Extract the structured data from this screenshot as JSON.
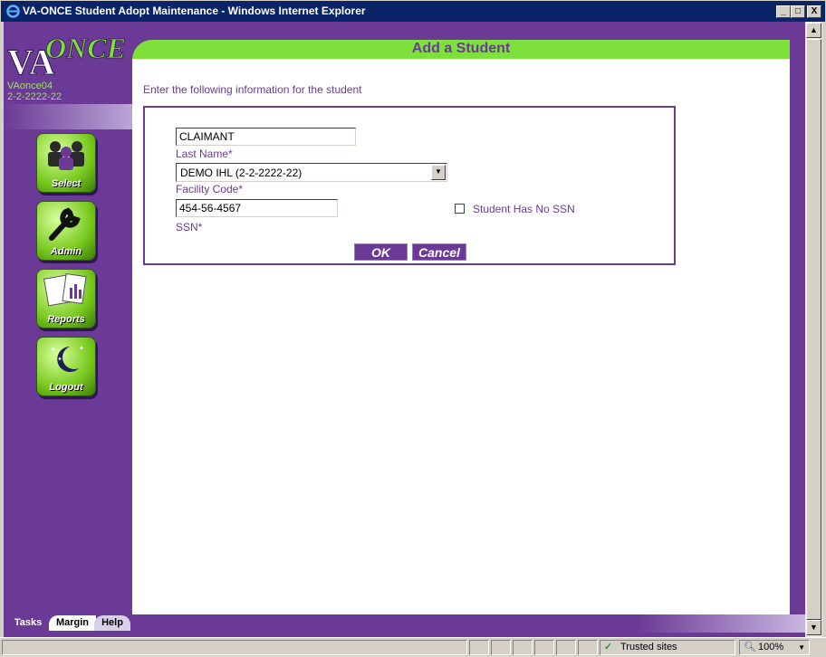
{
  "window": {
    "title": "VA-ONCE Student Adopt Maintenance - Windows Internet Explorer",
    "minimize": "_",
    "maximize": "□",
    "close": "X"
  },
  "sidebar": {
    "logo_text_va": "VA",
    "logo_text_once": "ONCE",
    "user": "VAonce04",
    "facility": "2-2-2222-22",
    "buttons": [
      {
        "label": "Select"
      },
      {
        "label": "Admin"
      },
      {
        "label": "Reports"
      },
      {
        "label": "Logout"
      }
    ],
    "tabs": [
      "Tasks",
      "Margin",
      "Help"
    ]
  },
  "header": {
    "title": "Add a Student"
  },
  "form": {
    "intro": "Enter the following information for the student",
    "last_name_value": "CLAIMANT",
    "last_name_label": "Last Name*",
    "facility_value": "DEMO IHL (2-2-2222-22)",
    "facility_label": "Facility Code*",
    "ssn_value": "454-56-4567",
    "ssn_label": "SSN*",
    "no_ssn_label": "Student Has No SSN",
    "ok_label": "OK",
    "cancel_label": "Cancel"
  },
  "statusbar": {
    "zone": "Trusted sites",
    "zoom": "100%"
  },
  "colors": {
    "purple": "#6b3a96",
    "green": "#7ee03a",
    "title_blue": "#0a246a"
  }
}
